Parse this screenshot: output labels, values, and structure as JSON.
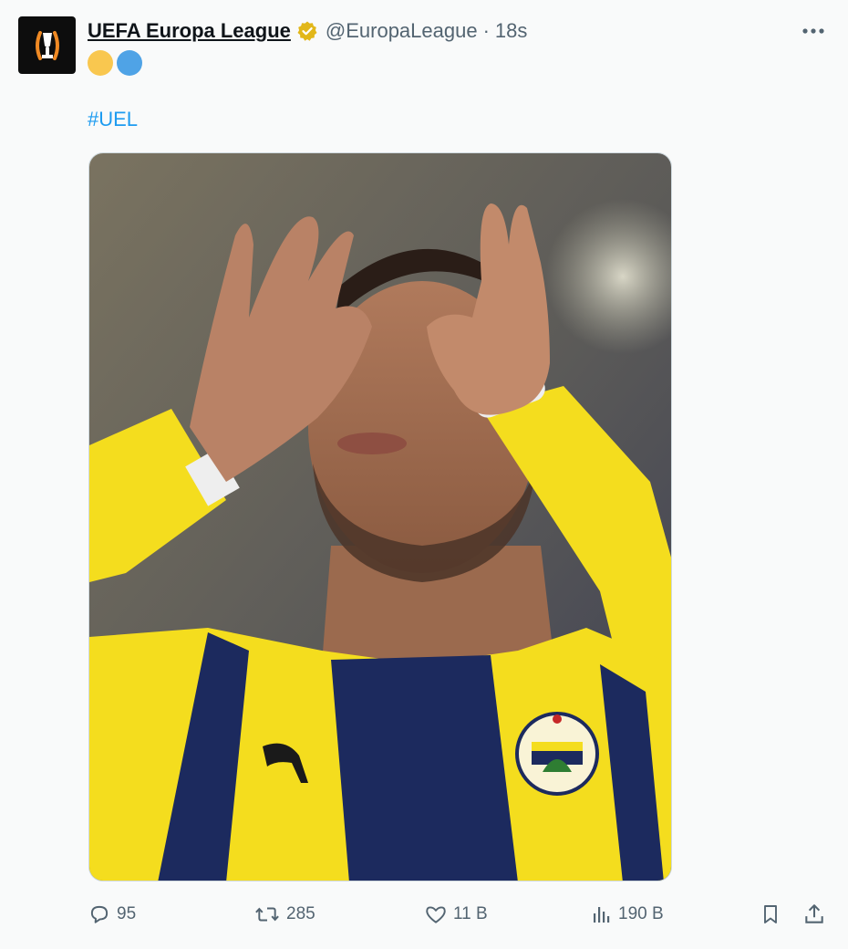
{
  "tweet": {
    "display_name": "UEFA Europa League",
    "handle": "@EuropaLeague",
    "separator": "·",
    "time": "18s",
    "emoji_colors": [
      "#f9c74f",
      "#4fa3e6"
    ],
    "hashtag": "#UEL",
    "verified_icon": "verified-badge-icon",
    "more_icon": "more-options-icon"
  },
  "media": {
    "description_icon": "photo-player-celebration",
    "jersey_colors": [
      "#f4dd1e",
      "#1c2a5e"
    ]
  },
  "actions": {
    "reply_count": "95",
    "retweet_count": "285",
    "like_count": "11 B",
    "views_count": "190 B"
  }
}
